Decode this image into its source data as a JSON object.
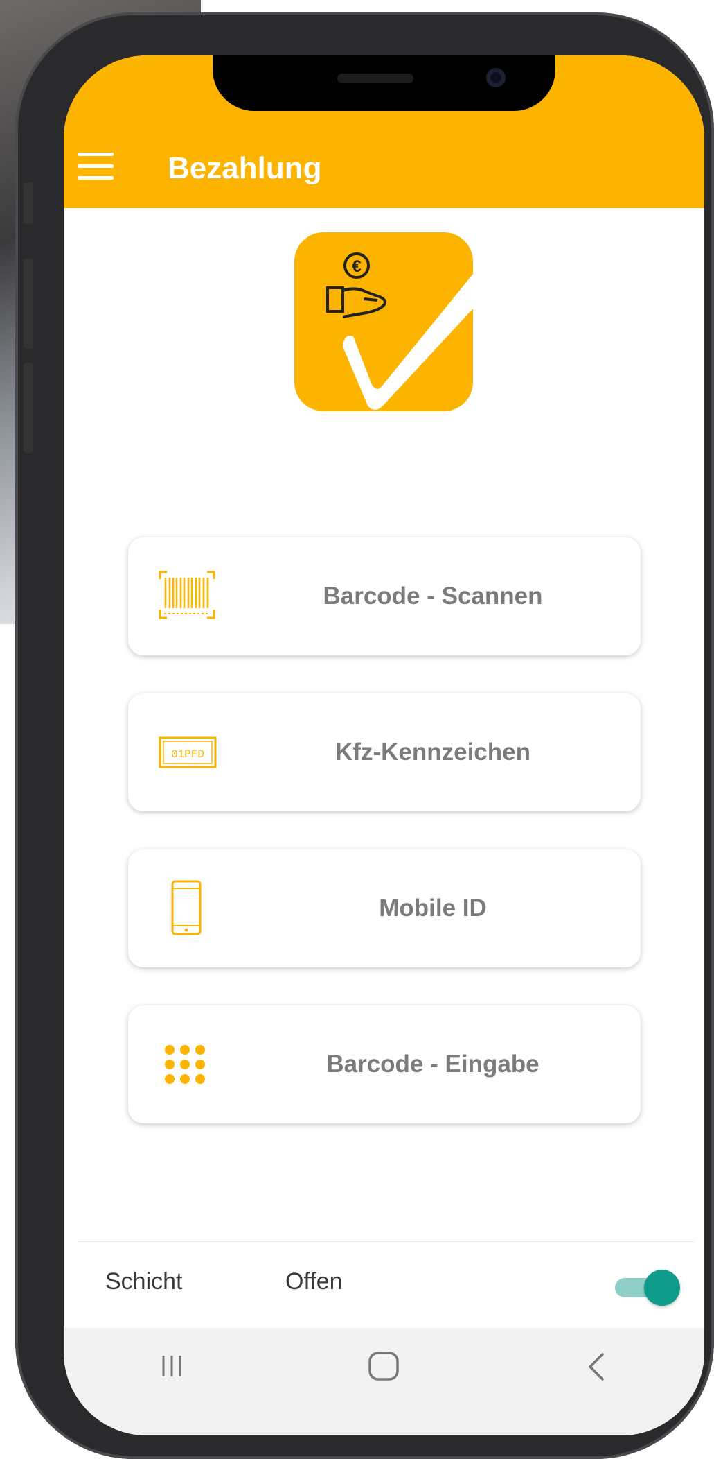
{
  "appbar": {
    "title": "Bezahlung",
    "background": "#fcb400"
  },
  "menu": [
    {
      "label": "Barcode - Scannen",
      "icon": "barcode-scan-icon"
    },
    {
      "label": "Kfz-Kennzeichen",
      "icon": "license-plate-icon"
    },
    {
      "label": "Mobile ID",
      "icon": "smartphone-icon"
    },
    {
      "label": "Barcode - Eingabe",
      "icon": "keypad-icon"
    }
  ],
  "logo": {
    "icon": "payment-checkmark-icon",
    "currency_symbol": "€"
  },
  "license_plate_text": "01PFD",
  "shift": {
    "label": "Schicht",
    "status": "Offen",
    "toggle_on": true,
    "toggle_color": "#0f9b8a"
  },
  "navigation": {
    "icons": [
      "recent-apps-icon",
      "home-icon",
      "back-icon"
    ]
  },
  "colors": {
    "accent": "#fcb400",
    "button_text": "#7b7b7b"
  }
}
